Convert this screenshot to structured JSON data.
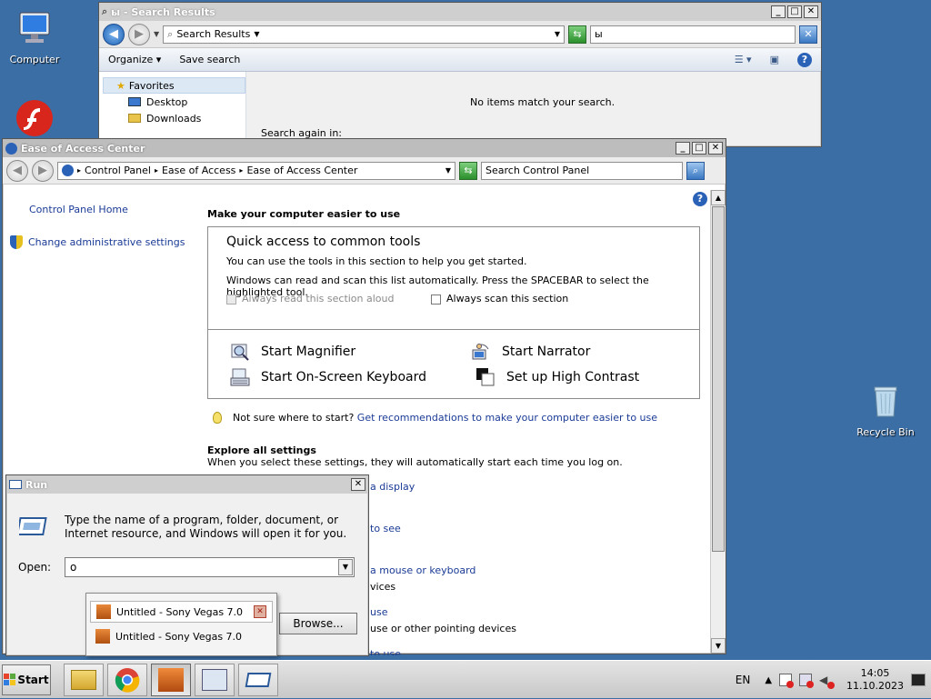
{
  "desktop": {
    "computer_label": "Computer",
    "recycle_label": "Recycle Bin"
  },
  "search_window": {
    "title": "ы - Search Results",
    "address": "Search Results",
    "search_value": "ы",
    "organize": "Organize",
    "save_search": "Save search",
    "favorites": "Favorites",
    "nav_items": [
      "Desktop",
      "Downloads"
    ],
    "no_items": "No items match your search.",
    "search_again": "Search again in:"
  },
  "eoa_window": {
    "title": "Ease of Access Center",
    "breadcrumb": [
      "Control Panel",
      "Ease of Access",
      "Ease of Access Center"
    ],
    "search_placeholder": "Search Control Panel",
    "cp_home": "Control Panel Home",
    "change_admin": "Change administrative settings",
    "heading": "Make your computer easier to use",
    "quick_title": "Quick access to common tools",
    "quick_line1": "You can use the tools in this section to help you get started.",
    "quick_line2": "Windows can read and scan this list automatically.  Press the SPACEBAR to select the highlighted tool.",
    "always_read": "Always read this section aloud",
    "always_scan": "Always scan this section",
    "tools": {
      "magnifier": "Start Magnifier",
      "narrator": "Start Narrator",
      "osk": "Start On-Screen Keyboard",
      "contrast": "Set up High Contrast"
    },
    "not_sure": "Not sure where to start?",
    "get_rec": "Get recommendations to make your computer easier to use",
    "explore_title": "Explore all settings",
    "explore_desc": "When you select these settings, they will automatically start each time you log on.",
    "partial_links": [
      "a display",
      "to see",
      "a mouse or keyboard",
      "vices",
      "use",
      "use or other pointing devices",
      "to use"
    ]
  },
  "run_dialog": {
    "title": "Run",
    "description": "Type the name of a program, folder, document, or Internet resource, and Windows will open it for you.",
    "open_label": "Open:",
    "open_value": "o",
    "browse": "Browse..."
  },
  "vegas_popup": {
    "items": [
      "Untitled - Sony Vegas 7.0",
      "Untitled - Sony Vegas 7.0"
    ]
  },
  "taskbar": {
    "start": "Start",
    "lang": "EN",
    "time": "14:05",
    "date": "11.10.2023"
  },
  "colors": {
    "desktop": "#3a6ea5",
    "link": "#1a3a96"
  }
}
